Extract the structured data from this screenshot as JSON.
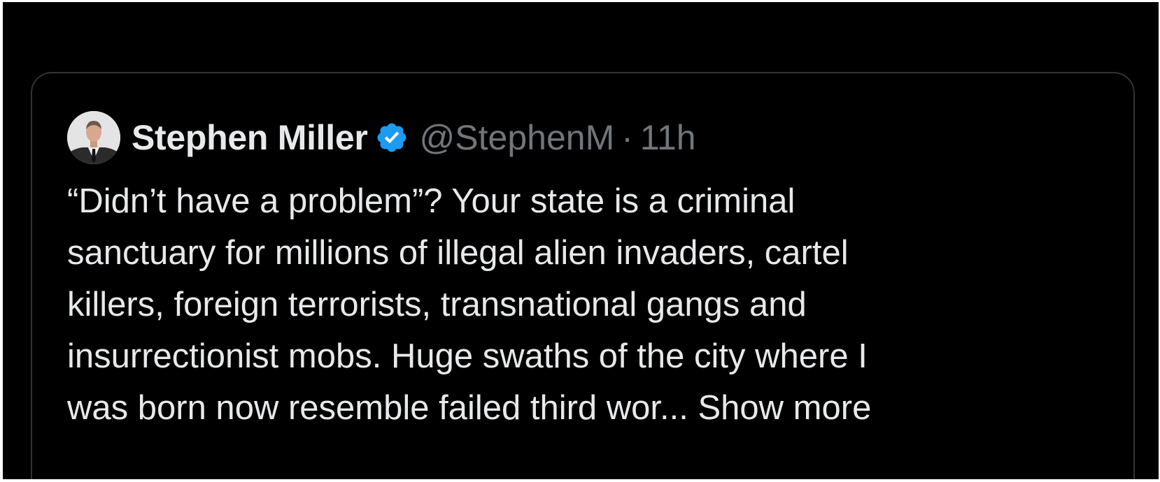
{
  "tweet": {
    "author": {
      "name": "Stephen Miller",
      "handle": "@StephenM",
      "verified": true,
      "verified_color": "#1d9bf0",
      "avatar_icon": "profile-photo"
    },
    "separator": "·",
    "timestamp": "11h",
    "body_lines": [
      "“Didn’t have a problem”? Your state is a criminal",
      "sanctuary for millions of illegal alien invaders, cartel",
      "killers, foreign terrorists, transnational gangs and",
      "insurrectionist mobs. Huge swaths of the city where I",
      "was born now resemble failed third wor..."
    ],
    "show_more_label": "Show more"
  },
  "colors": {
    "background": "#000000",
    "card_border": "#2f3336",
    "primary_text": "#e7e9ea",
    "secondary_text": "#71767b"
  }
}
